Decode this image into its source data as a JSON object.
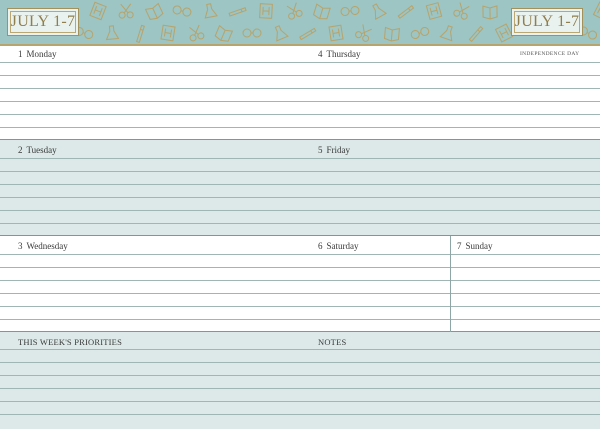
{
  "header": {
    "range_left": "JULY 1-7",
    "range_right": "JULY 1-7",
    "pattern_icons": [
      "glasses-icon",
      "flask-icon",
      "pencil-icon",
      "letter-h-icon",
      "scissors-icon",
      "book-icon"
    ]
  },
  "days": [
    {
      "num": "1",
      "name": "Monday"
    },
    {
      "num": "4",
      "name": "Thursday",
      "note": "INDEPENDENCE DAY"
    },
    {
      "num": "2",
      "name": "Tuesday"
    },
    {
      "num": "5",
      "name": "Friday"
    },
    {
      "num": "3",
      "name": "Wednesday"
    },
    {
      "num": "6",
      "name": "Saturday"
    },
    {
      "num": "7",
      "name": "Sunday"
    }
  ],
  "sections": {
    "priorities": "THIS WEEK'S PRIORITIES",
    "notes": "NOTES"
  },
  "colors": {
    "banner": "#9cc5c4",
    "tint": "#dce9e8",
    "gold": "#a3915c",
    "rule": "#9fb6b5"
  }
}
